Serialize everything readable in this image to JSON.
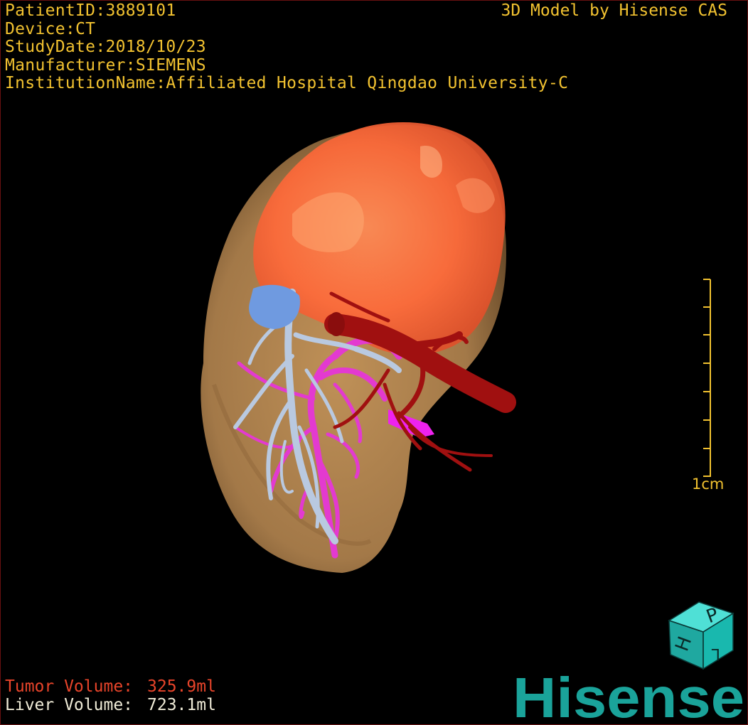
{
  "header": {
    "patient_id": "PatientID:3889101",
    "device": "Device:CT",
    "study_date": "StudyDate:2018/10/23",
    "manufacturer": "Manufacturer:SIEMENS",
    "institution": "InstitutionName:Affiliated Hospital Qingdao University-C"
  },
  "credit": "3D Model by Hisense CAS",
  "scale_bar": {
    "label": "1cm"
  },
  "volumes": {
    "tumor_label": "Tumor Volume:",
    "tumor_value": "325.9ml",
    "liver_label": "Liver Volume:",
    "liver_value": "723.1ml"
  },
  "orientation_cube": {
    "letters": [
      "H",
      "P",
      "L"
    ]
  },
  "brand": "Hisense",
  "colors": {
    "overlay_text": "#f2c230",
    "tumor_text": "#e8442a",
    "liver_text": "#f0ecd8",
    "liver": "#d9a56a",
    "tumor": "#ff6b3a",
    "portal_vein": "#b9c9e0",
    "hepatic_vein": "#e33ad0",
    "artery": "#a01010",
    "brand": "#1aa39a"
  },
  "icons": {
    "orientation": "orientation-cube-icon",
    "logo": "hisense-logo"
  }
}
